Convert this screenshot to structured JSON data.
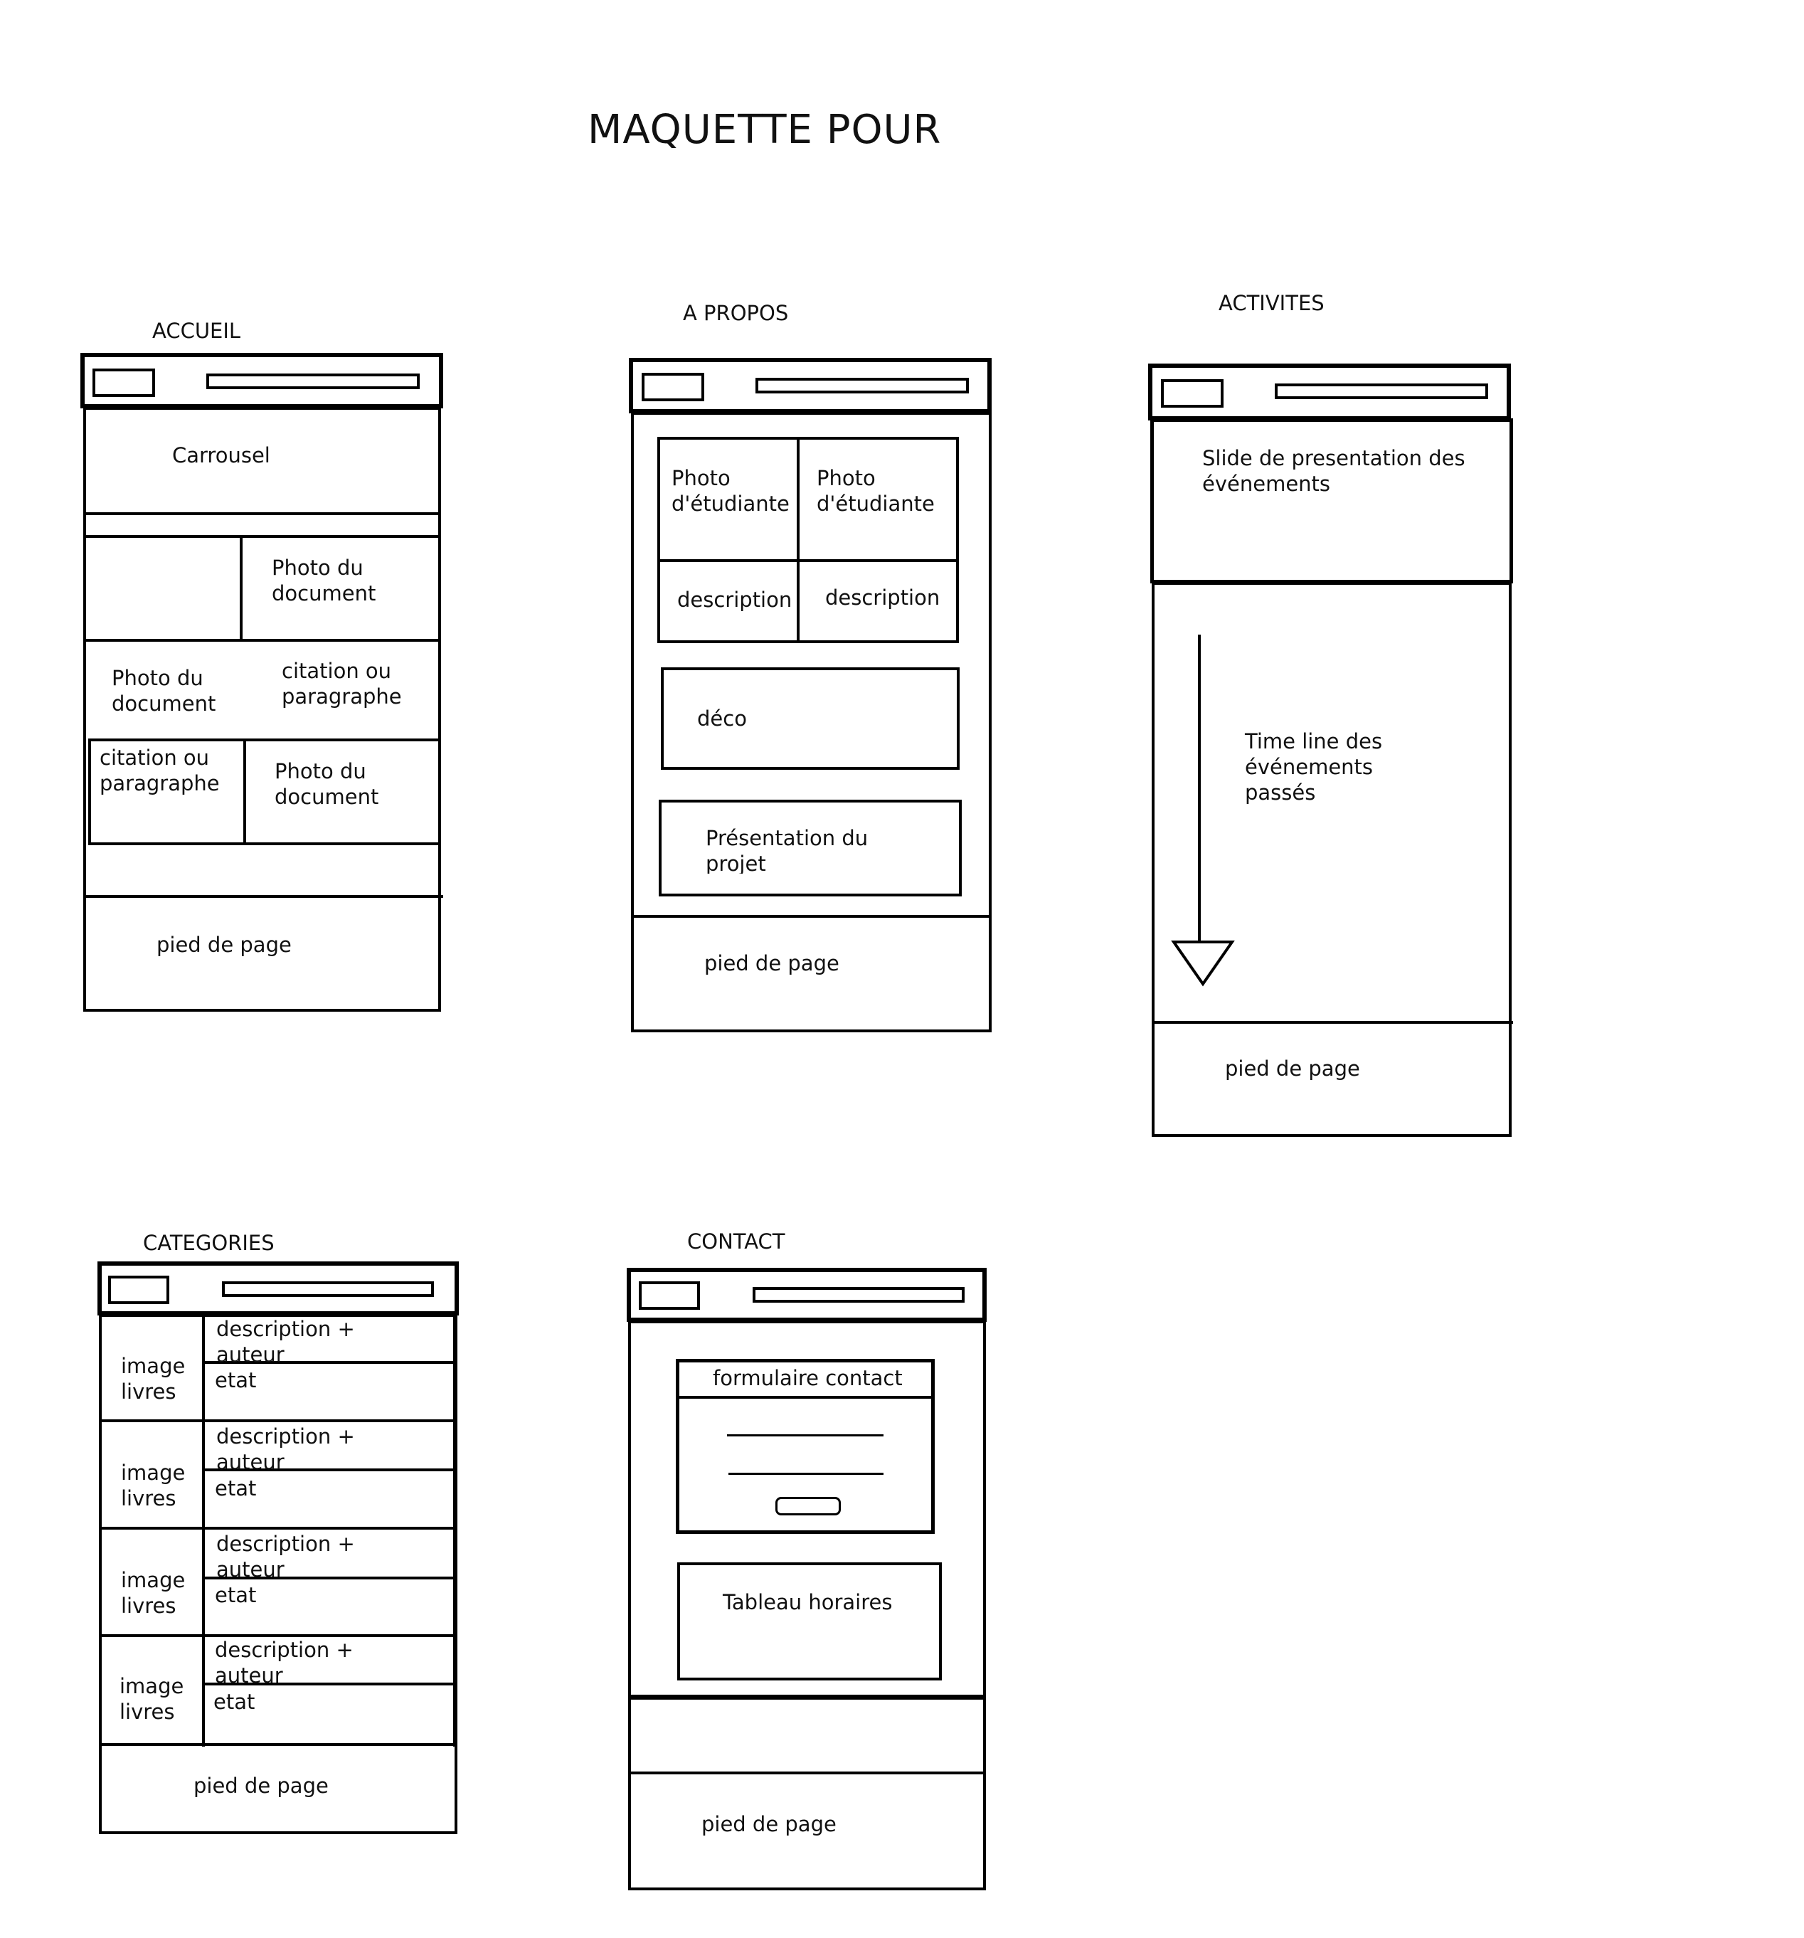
{
  "title": "MAQUETTE POUR",
  "accueil": {
    "label": "ACCUEIL",
    "carrousel": "Carrousel",
    "photo_doc_1": "Photo du\ndocument",
    "photo_doc_2": "Photo du\ndocument",
    "citation_1": "citation ou\nparagraphe",
    "citation_2": "citation ou\nparagraphe",
    "photo_doc_3": "Photo du\ndocument",
    "footer": "pied de page"
  },
  "apropos": {
    "label": "A PROPOS",
    "photo_1": "Photo\nd'étudiante",
    "photo_2": "Photo\nd'étudiante",
    "desc_1": "description",
    "desc_2": "description",
    "deco": "déco",
    "presentation": "Présentation du\nprojet",
    "footer": "pied de page"
  },
  "activites": {
    "label": "ACTIVITES",
    "slide": "Slide de presentation des\névénements",
    "timeline": "Time line des\névénements\npassés",
    "footer": "pied de page"
  },
  "categories": {
    "label": "CATEGORIES",
    "rows": [
      {
        "image": "image\nlivres",
        "desc": "description +\nauteur",
        "etat": "etat"
      },
      {
        "image": "image\nlivres",
        "desc": "description +\nauteur",
        "etat": "etat"
      },
      {
        "image": "image\nlivres",
        "desc": "description +\nauteur",
        "etat": "etat"
      },
      {
        "image": "image\nlivres",
        "desc": "description +\nauteur",
        "etat": "etat"
      }
    ],
    "footer": "pied de page"
  },
  "contact": {
    "label": "CONTACT",
    "form_title": "formulaire contact",
    "horaires": "Tableau horaires",
    "footer": "pied de page"
  }
}
